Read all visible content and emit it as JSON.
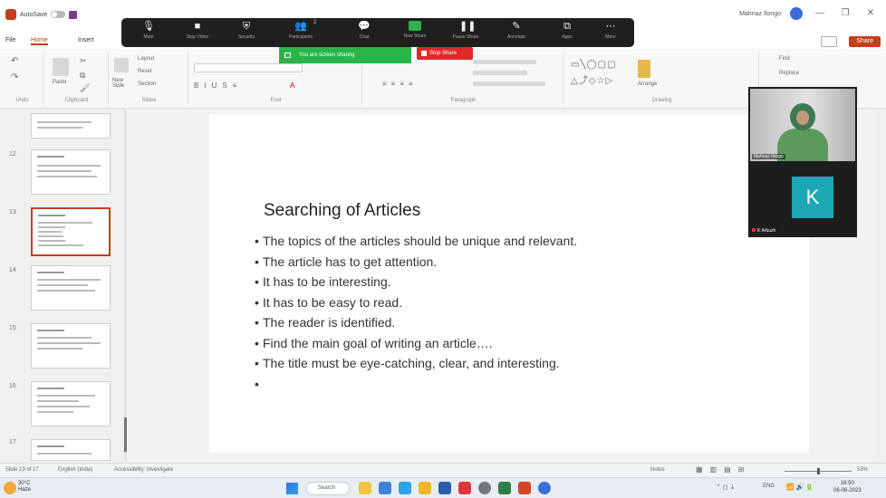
{
  "window": {
    "autosave_label": "AutoSave",
    "user_name": "Mahnaz Ilongo",
    "min": "—",
    "restore": "❐",
    "close": "✕"
  },
  "menu": {
    "tabs": [
      "File",
      "Home",
      "Insert"
    ],
    "active_tab": "Home",
    "share_label": "Share"
  },
  "ribbon": {
    "groups": [
      "Undo",
      "Clipboard",
      "Slides",
      "Font",
      "Paragraph",
      "Drawing"
    ],
    "paste_label": "Paste",
    "new_slide_label": "New Slide",
    "layout_label": "Layout",
    "reset_label": "Reset",
    "section_label": "Section",
    "arrange_label": "Arrange",
    "find_label": "Find",
    "replace_label": "Replace"
  },
  "zoom_toolbar": {
    "items": [
      {
        "label": "Mute",
        "icon": "microphone-icon",
        "glyph": "🎙"
      },
      {
        "label": "Stop Video",
        "icon": "video-camera-icon",
        "glyph": "■"
      },
      {
        "label": "Security",
        "icon": "shield-icon",
        "glyph": "⛨"
      },
      {
        "label": "Participants",
        "icon": "participants-icon",
        "glyph": "👥"
      },
      {
        "label": "Chat",
        "icon": "chat-icon",
        "glyph": "💬"
      },
      {
        "label": "New Share",
        "icon": "share-screen-icon",
        "glyph": ""
      },
      {
        "label": "Pause Share",
        "icon": "pause-icon",
        "glyph": "❚❚"
      },
      {
        "label": "Annotate",
        "icon": "pen-icon",
        "glyph": "✎"
      },
      {
        "label": "Apps",
        "icon": "apps-icon",
        "glyph": "⧉"
      },
      {
        "label": "More",
        "icon": "more-icon",
        "glyph": "⋯"
      }
    ],
    "participant_count": "2",
    "sharing_banner": "You are screen sharing",
    "stop_share_label": "Stop Share"
  },
  "zoom_participants": {
    "video_name": "Mahnaz Ilongo",
    "k_initial": "K",
    "k_name": "K Arbuzh"
  },
  "slide": {
    "title": "Searching of Articles",
    "bullets": [
      "The topics of the articles should be unique and relevant.",
      "The article has to get attention.",
      "It has to be interesting.",
      "It has to be easy to read.",
      "The reader is identified.",
      "Find the main goal of writing an article….",
      "The title must be eye-catching, clear, and interesting.",
      ""
    ]
  },
  "thumbnails": {
    "numbers": [
      "12",
      "13",
      "14",
      "15",
      "16",
      "17"
    ]
  },
  "status": {
    "slide_info": "Slide 13 of 17",
    "language": "English (India)",
    "accessibility": "Accessibility: Investigate",
    "notes_label": "Notes",
    "zoom_level": "53%"
  },
  "taskbar": {
    "weather_temp": "30°C",
    "weather_desc": "Haze",
    "search_label": "Search",
    "time": "18:50",
    "date": "06-06-2023",
    "lang": "ENG"
  }
}
